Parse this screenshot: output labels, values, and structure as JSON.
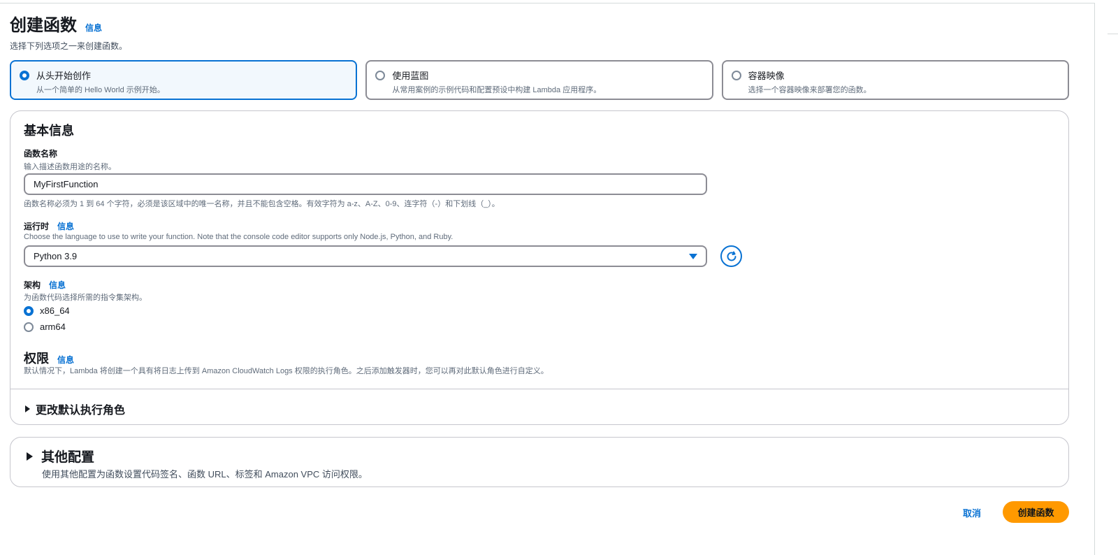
{
  "header": {
    "title": "创建函数",
    "info": "信息",
    "description": "选择下列选项之一来创建函数。"
  },
  "options": [
    {
      "label": "从头开始创作",
      "description": "从一个简单的 Hello World 示例开始。",
      "selected": true
    },
    {
      "label": "使用蓝图",
      "description": "从常用案例的示例代码和配置预设中构建 Lambda 应用程序。",
      "selected": false
    },
    {
      "label": "容器映像",
      "description": "选择一个容器映像来部署您的函数。",
      "selected": false
    }
  ],
  "basic": {
    "heading": "基本信息",
    "function_name": {
      "label": "函数名称",
      "description": "输入描述函数用途的名称。",
      "value": "MyFirstFunction",
      "constraint": "函数名称必须为 1 到 64 个字符，必须是该区域中的唯一名称，并且不能包含空格。有效字符为 a-z、A-Z、0-9、连字符（-）和下划线（_）。"
    },
    "runtime": {
      "label": "运行时",
      "info": "信息",
      "description": "Choose the language to use to write your function. Note that the console code editor supports only Node.js, Python, and Ruby.",
      "value": "Python 3.9"
    },
    "architecture": {
      "label": "架构",
      "info": "信息",
      "description": "为函数代码选择所需的指令集架构。",
      "options": [
        "x86_64",
        "arm64"
      ],
      "selected": "x86_64"
    },
    "permissions": {
      "heading": "权限",
      "info": "信息",
      "description": "默认情况下，Lambda 将创建一个具有将日志上传到 Amazon CloudWatch Logs 权限的执行角色。之后添加触发器时，您可以再对此默认角色进行自定义。"
    },
    "expander_label": "更改默认执行角色"
  },
  "advanced": {
    "heading": "其他配置",
    "description": "使用其他配置为函数设置代码签名、函数 URL、标签和 Amazon VPC 访问权限。"
  },
  "footer": {
    "cancel": "取消",
    "create": "创建函数"
  },
  "colors": {
    "accent": "#0972d3",
    "primary_button": "#ff9900"
  }
}
